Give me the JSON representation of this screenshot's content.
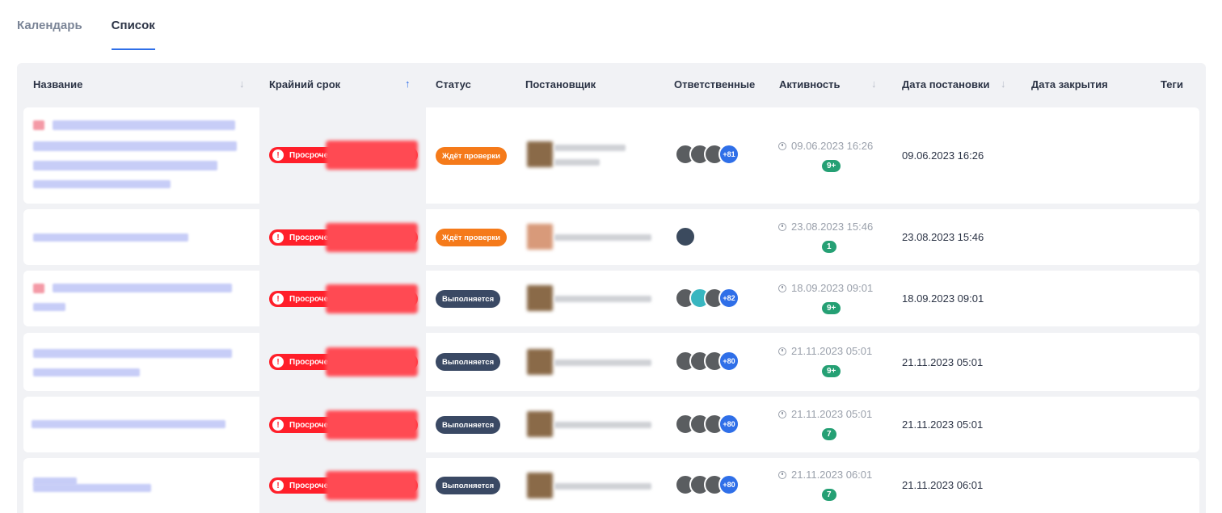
{
  "tabs": [
    {
      "label": "Календарь",
      "active": false
    },
    {
      "label": "Список",
      "active": true
    }
  ],
  "columns": {
    "name": "Название",
    "deadline": "Крайний срок",
    "status": "Статус",
    "creator": "Постановщик",
    "assignees": "Ответственные",
    "activity": "Активность",
    "created": "Дата постановки",
    "closed": "Дата закрытия",
    "tags": "Теги"
  },
  "sort_icons": {
    "name": "↓",
    "deadline": "↑",
    "activity": "↓",
    "created": "↓"
  },
  "overdue_label": "Просроче",
  "overdue_icon": "!",
  "rows": [
    {
      "status": "Ждёт проверки",
      "plus": "+81",
      "activity_time": "09.06.2023 16:26",
      "activity_count": "9+",
      "created": "09.06.2023 16:26"
    },
    {
      "status": "Ждёт проверки",
      "plus": "",
      "activity_time": "23.08.2023 15:46",
      "activity_count": "1",
      "created": "23.08.2023 15:46"
    },
    {
      "status": "Выполняется",
      "plus": "+82",
      "activity_time": "18.09.2023 09:01",
      "activity_count": "9+",
      "created": "18.09.2023 09:01"
    },
    {
      "status": "Выполняется",
      "plus": "+80",
      "activity_time": "21.11.2023 05:01",
      "activity_count": "9+",
      "created": "21.11.2023 05:01"
    },
    {
      "status": "Выполняется",
      "plus": "+80",
      "activity_time": "21.11.2023 05:01",
      "activity_count": "7",
      "created": "21.11.2023 05:01"
    },
    {
      "status": "Выполняется",
      "plus": "+80",
      "activity_time": "21.11.2023 06:01",
      "activity_count": "7",
      "created": "21.11.2023 06:01"
    }
  ],
  "colors": {
    "accent": "#2f6fe8",
    "overdue": "#ff1f2a",
    "review": "#f57a1a",
    "in_progress": "#3a4964",
    "activity_badge": "#25a074"
  }
}
